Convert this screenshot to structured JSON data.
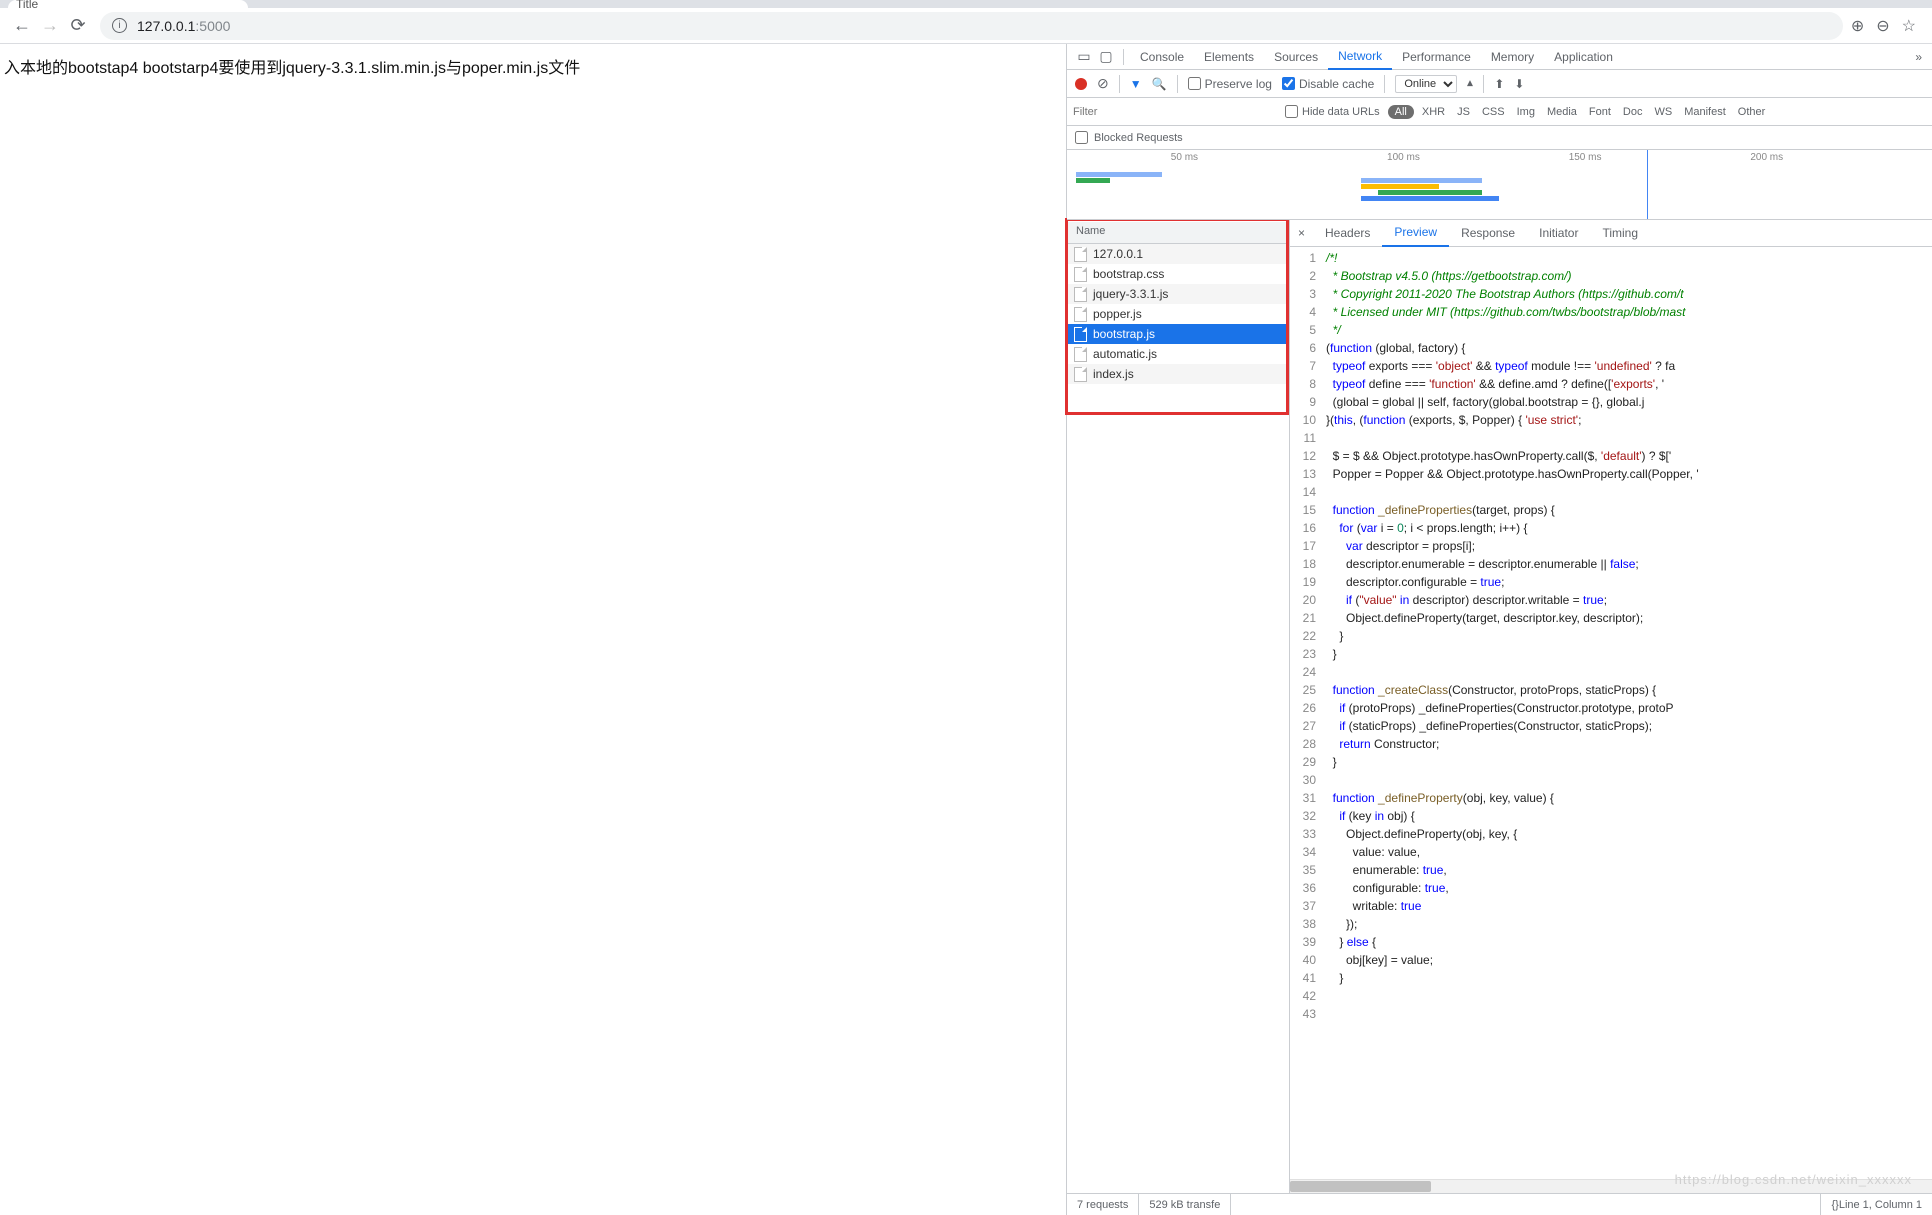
{
  "browser": {
    "tab_title": "Title",
    "url_host": "127.0.0.1",
    "url_port": ":5000"
  },
  "page": {
    "body_text": "入本地的bootstap4 bootstarp4要使用到jquery-3.3.1.slim.min.js与poper.min.js文件"
  },
  "devtools": {
    "tabs": [
      "Console",
      "Elements",
      "Sources",
      "Network",
      "Performance",
      "Memory",
      "Application"
    ],
    "active_tab": "Network",
    "preserve_log_label": "Preserve log",
    "preserve_log_checked": false,
    "disable_cache_label": "Disable cache",
    "disable_cache_checked": true,
    "throttling": "Online",
    "filter_placeholder": "Filter",
    "hide_data_urls_label": "Hide data URLs",
    "filter_all": "All",
    "filter_types": [
      "XHR",
      "JS",
      "CSS",
      "Img",
      "Media",
      "Font",
      "Doc",
      "WS",
      "Manifest",
      "Other"
    ],
    "blocked_label": "Blocked Requests",
    "timeline": {
      "ticks": [
        "50 ms",
        "100 ms",
        "150 ms",
        "200 ms"
      ]
    },
    "requests_header": "Name",
    "requests": [
      {
        "name": "127.0.0.1",
        "selected": false
      },
      {
        "name": "bootstrap.css",
        "selected": false
      },
      {
        "name": "jquery-3.3.1.js",
        "selected": false
      },
      {
        "name": "popper.js",
        "selected": false
      },
      {
        "name": "bootstrap.js",
        "selected": true
      },
      {
        "name": "automatic.js",
        "selected": false
      },
      {
        "name": "index.js",
        "selected": false
      }
    ],
    "detail_tabs": [
      "Headers",
      "Preview",
      "Response",
      "Initiator",
      "Timing"
    ],
    "detail_active": "Preview",
    "status_requests": "7 requests",
    "status_transfer": "529 kB transfe",
    "status_linecol": "Line 1, Column 1",
    "code_lines": [
      {
        "n": 1,
        "h": "<span class='c-comment'>/*!</span>"
      },
      {
        "n": 2,
        "h": "<span class='c-comment'>  * Bootstrap v4.5.0 (https://getbootstrap.com/)</span>"
      },
      {
        "n": 3,
        "h": "<span class='c-comment'>  * Copyright 2011-2020 The Bootstrap Authors (https://github.com/t</span>"
      },
      {
        "n": 4,
        "h": "<span class='c-comment'>  * Licensed under MIT (https://github.com/twbs/bootstrap/blob/mast</span>"
      },
      {
        "n": 5,
        "h": "<span class='c-comment'>  */</span>"
      },
      {
        "n": 6,
        "h": "(<span class='c-kw'>function</span> (global, factory) {"
      },
      {
        "n": 7,
        "h": "  <span class='c-kw'>typeof</span> exports === <span class='c-str'>'object'</span> &amp;&amp; <span class='c-kw'>typeof</span> module !== <span class='c-str'>'undefined'</span> ? fa"
      },
      {
        "n": 8,
        "h": "  <span class='c-kw'>typeof</span> define === <span class='c-str'>'function'</span> &amp;&amp; define.amd ? define([<span class='c-str'>'exports'</span>, '"
      },
      {
        "n": 9,
        "h": "  (global = global || self, factory(global.bootstrap = {}, global.j"
      },
      {
        "n": 10,
        "h": "}(<span class='c-kw'>this</span>, (<span class='c-kw'>function</span> (exports, $, Popper) { <span class='c-str'>'use strict'</span>;"
      },
      {
        "n": 11,
        "h": ""
      },
      {
        "n": 12,
        "h": "  $ = $ &amp;&amp; Object.prototype.hasOwnProperty.call($, <span class='c-str'>'default'</span>) ? $['"
      },
      {
        "n": 13,
        "h": "  Popper = Popper &amp;&amp; Object.prototype.hasOwnProperty.call(Popper, '"
      },
      {
        "n": 14,
        "h": ""
      },
      {
        "n": 15,
        "h": "  <span class='c-kw'>function</span> <span class='c-fn'>_defineProperties</span>(target, props) {"
      },
      {
        "n": 16,
        "h": "    <span class='c-kw'>for</span> (<span class='c-kw'>var</span> i = <span class='c-num'>0</span>; i &lt; props.length; i++) {"
      },
      {
        "n": 17,
        "h": "      <span class='c-kw'>var</span> descriptor = props[i];"
      },
      {
        "n": 18,
        "h": "      descriptor.enumerable = descriptor.enumerable || <span class='c-kw'>false</span>;"
      },
      {
        "n": 19,
        "h": "      descriptor.configurable = <span class='c-kw'>true</span>;"
      },
      {
        "n": 20,
        "h": "      <span class='c-kw'>if</span> (<span class='c-str'>\"value\"</span> <span class='c-kw'>in</span> descriptor) descriptor.writable = <span class='c-kw'>true</span>;"
      },
      {
        "n": 21,
        "h": "      Object.defineProperty(target, descriptor.key, descriptor);"
      },
      {
        "n": 22,
        "h": "    }"
      },
      {
        "n": 23,
        "h": "  }"
      },
      {
        "n": 24,
        "h": ""
      },
      {
        "n": 25,
        "h": "  <span class='c-kw'>function</span> <span class='c-fn'>_createClass</span>(Constructor, protoProps, staticProps) {"
      },
      {
        "n": 26,
        "h": "    <span class='c-kw'>if</span> (protoProps) _defineProperties(Constructor.prototype, protoP"
      },
      {
        "n": 27,
        "h": "    <span class='c-kw'>if</span> (staticProps) _defineProperties(Constructor, staticProps);"
      },
      {
        "n": 28,
        "h": "    <span class='c-kw'>return</span> Constructor;"
      },
      {
        "n": 29,
        "h": "  }"
      },
      {
        "n": 30,
        "h": ""
      },
      {
        "n": 31,
        "h": "  <span class='c-kw'>function</span> <span class='c-fn'>_defineProperty</span>(obj, key, value) {"
      },
      {
        "n": 32,
        "h": "    <span class='c-kw'>if</span> (key <span class='c-kw'>in</span> obj) {"
      },
      {
        "n": 33,
        "h": "      Object.defineProperty(obj, key, {"
      },
      {
        "n": 34,
        "h": "        value: value,"
      },
      {
        "n": 35,
        "h": "        enumerable: <span class='c-kw'>true</span>,"
      },
      {
        "n": 36,
        "h": "        configurable: <span class='c-kw'>true</span>,"
      },
      {
        "n": 37,
        "h": "        writable: <span class='c-kw'>true</span>"
      },
      {
        "n": 38,
        "h": "      });"
      },
      {
        "n": 39,
        "h": "    } <span class='c-kw'>else</span> {"
      },
      {
        "n": 40,
        "h": "      obj[key] = value;"
      },
      {
        "n": 41,
        "h": "    }"
      },
      {
        "n": 42,
        "h": ""
      },
      {
        "n": 43,
        "h": ""
      }
    ]
  },
  "watermark": "https://blog.csdn.net/weixin_xxxxxx"
}
